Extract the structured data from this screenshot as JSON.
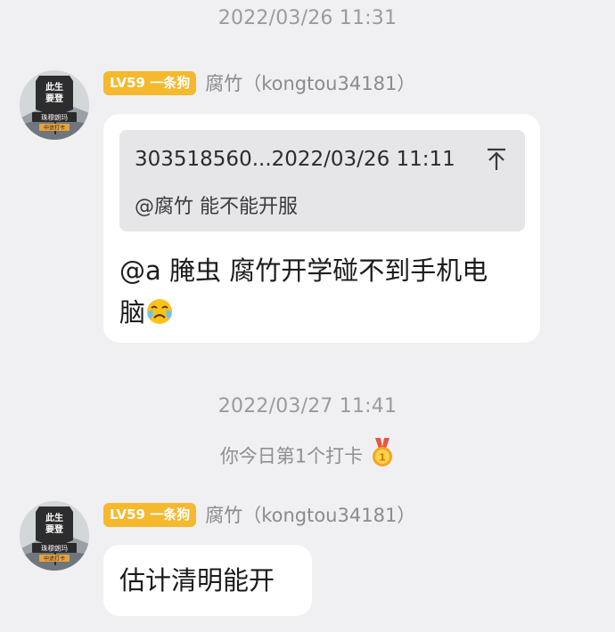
{
  "messages": [
    {
      "timestamp": "2022/03/26 11:31",
      "sender": {
        "level": "LV59 一条狗",
        "name": "腐竹（kongtou34181）",
        "avatar_icon": "avatar-badge-icon",
        "avatar_text_top": "此生",
        "avatar_text_mid": "要登",
        "avatar_text_bottom": "珠穆朗玛",
        "avatar_text_tag": "中途打卡"
      },
      "quote": {
        "header": "303518560...2022/03/26 11:11",
        "body": "@腐竹 能不能开服",
        "icon": "pin-top-icon"
      },
      "text_line1": "@a 腌虫 腐竹开学碰不到手机电",
      "text_line2": "脑",
      "emoji": "crying-face-emoji"
    },
    {
      "timestamp": "2022/03/27 11:41",
      "system_note": "你今日第1个打卡",
      "medal_number": "1",
      "medal_icon": "medal-icon",
      "sender": {
        "level": "LV59 一条狗",
        "name": "腐竹（kongtou34181）",
        "avatar_text_top": "此生",
        "avatar_text_mid": "要登",
        "avatar_text_bottom": "珠穆朗玛",
        "avatar_text_tag": "中途打卡"
      },
      "text": "估计清明能开"
    }
  ],
  "colors": {
    "background": "#f0f0f2",
    "bubble": "#ffffff",
    "level_badge": "#f6b82d",
    "quote_background": "#e6e6e8",
    "meta_text": "#9a9a9f"
  }
}
